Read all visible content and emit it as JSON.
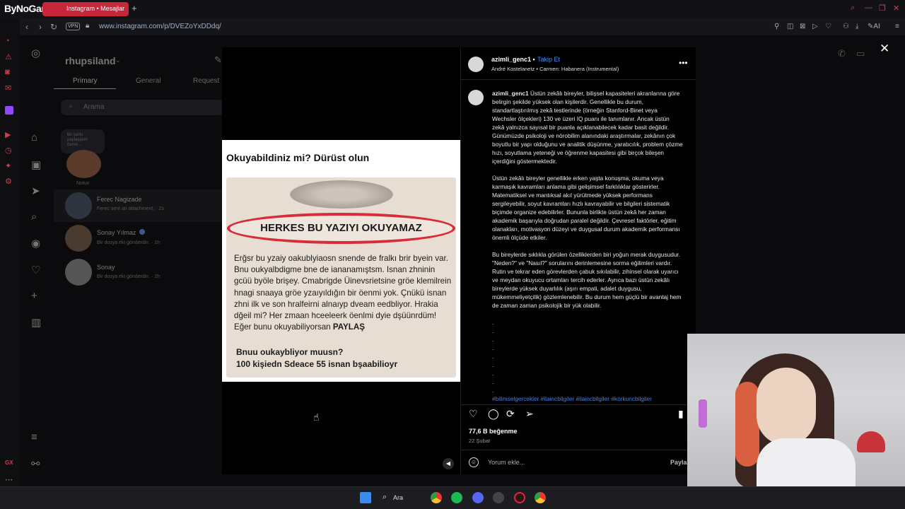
{
  "browser": {
    "brand": "ByNoGame",
    "tab_title": "Instagram • Mesajlar",
    "new_tab": "+",
    "vpn": "VPN",
    "url": "www.instagram.com/p/DVEZoYxDDdq/",
    "ai": "AI"
  },
  "ig_background": {
    "username": "rhupsiland",
    "tabs": [
      "Primary",
      "General",
      "Request"
    ],
    "search_placeholder": "Arama",
    "note_text": "Bir şarkı paylaşalım deme...",
    "note_label": "Notun",
    "conversations": [
      {
        "name": "Ferec Nagizade",
        "sub": "Ferec sent an attachment. · 2s"
      },
      {
        "name": "Sonay Yılmaz",
        "sub": "Bir dosya eki gönderdin. · 1h"
      },
      {
        "name": "Sonay",
        "sub": "Bir dosya eki gönderdin. · 2h"
      }
    ]
  },
  "post_image": {
    "title": "Okuyabildiniz mi? Dürüst olun",
    "banner": "HERKES BU YAZIYI OKUYAMAZ",
    "scrambled_text": "Erğsr bu yzaiy oakublyiaosn snende de fralkı brir byein var. Bnu oukyalbdigme bne de iananamıştsm. Isnan zhninin gcüü byöle brişey. Cmabrigde Üinevsrietsine gröe klemilrein hnagi snaaya gröe yzaıyıldığın bir öenmi yok. Çnükü isnan zhni ilk ve son hralfeirni alnaıyp dveam eedbliyor. Hrakia dğeil mi? Her zmaan hceeleerk öenlmi dyie dşüünrdüm! Eğer bunu okuyabiliyorsan",
    "scrambled_bold": "PAYLAŞ",
    "bottom_line1": "Bnuu oukaybliyor muusn?",
    "bottom_line2": "100 kişiedn Sdeace 55 isnan bşaabilioyr"
  },
  "post": {
    "username": "azimli_genc1",
    "follow": "Takip Et",
    "bullet": "•",
    "audio": "André Kostelanetz • Carmen: Habanera (Instrumental)",
    "more": "•••",
    "caption_p1": "Üstün zekâlı bireyler, bilişsel kapasiteleri akranlarına göre belirgin şekilde yüksek olan kişilerdir. Genellikle bu durum, standartlaştırılmış zekâ testlerinde (örneğin Stanford-Binet veya Wechsler ölçekleri) 130 ve üzeri IQ puanı ile tanımlanır. Ancak üstün zekâ yalnızca sayısal bir puanla açıklanabilecek kadar basit değildir. Günümüzde psikoloji ve nörobilim alanındaki araştırmalar, zekânın çok boyutlu bir yapı olduğunu ve analitik düşünme, yaratıcılık, problem çözme hızı, soyutlama yeteneği ve öğrenme kapasitesi gibi birçok bileşen içerdiğini göstermektedir.",
    "caption_p2": "Üstün zekâlı bireyler genellikle erken yaşta konuşma, okuma veya karmaşık kavramları anlama gibi gelişimsel farklılıklar gösterirler. Matematiksel ve mantıksal akıl yürütmede yüksek performans sergileyebilir, soyut kavramları hızlı kavrayabilir ve bilgileri sistematik biçimde organize edebilirler. Bununla birlikte üstün zekâ her zaman akademik başarıyla doğrudan paralel değildir. Çevresel faktörler, eğitim olanakları, motivasyon düzeyi ve duygusal durum akademik performansı önemli ölçüde etkiler.",
    "caption_p3": "Bu bireylerde sıklıkla görülen özelliklerden biri yoğun merak duygusudur. \"Neden?\" ve \"Nasıl?\" sorularını derinlemesine sorma eğilimleri vardır. Rutin ve tekrar eden görevlerden çabuk sıkılabilir, zihinsel olarak uyarıcı ve meydan okuyucu ortamları tercih ederler. Ayrıca bazı üstün zekâlı bireylerde yüksek duyarlılık (aşırı empati, adalet duygusu, mükemmeliyetçilik) gözlemlenebilir. Bu durum hem güçlü bir avantaj hem de zaman zaman psikolojik bir yük olabilir.",
    "dots": ".\n.\n.\n.\n.\n.\n.\n.\n.",
    "hashtags": "#bilimselgercekler #ilaincbilgiler #ilaincbilgiler #korkuncbilgiler",
    "likes": "77,6 B beğenme",
    "date": "22 Şubat",
    "comment_placeholder": "Yorum ekle...",
    "share": "Paylaş"
  },
  "taskbar": {
    "search": "Ara"
  },
  "colors": {
    "accent": "#c8273b",
    "link": "#4a8ff5"
  }
}
